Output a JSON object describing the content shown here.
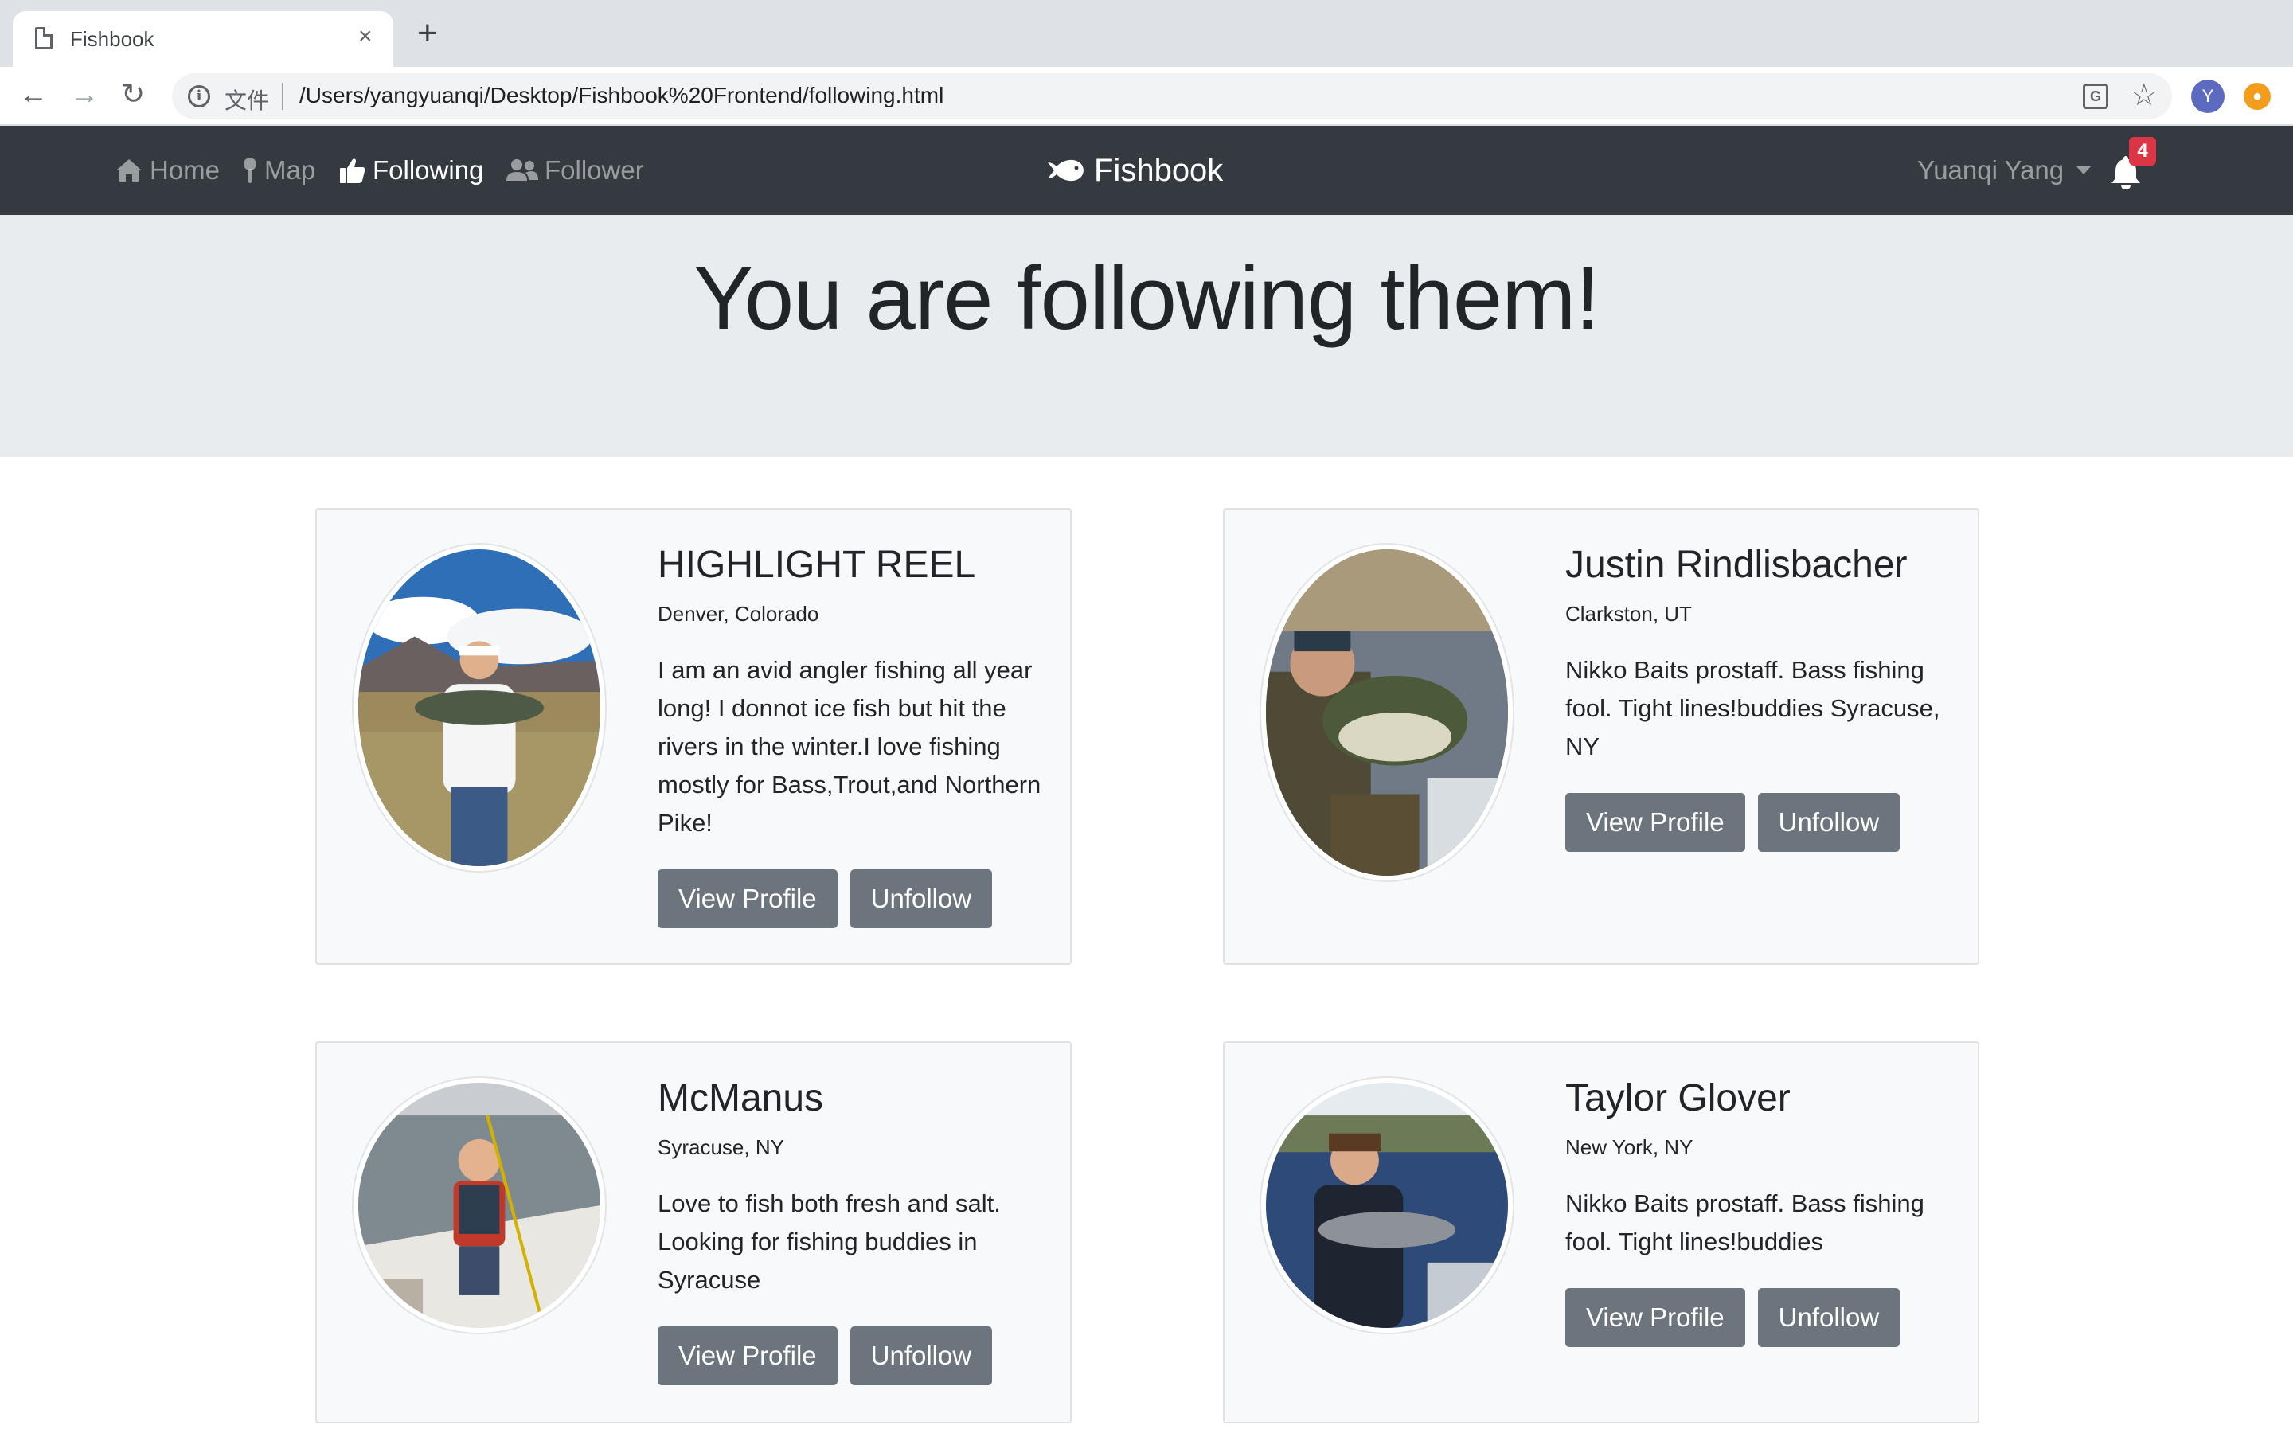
{
  "browser": {
    "tab_title": "Fishbook",
    "tab_close": "×",
    "new_tab": "+",
    "back": "←",
    "forward": "→",
    "reload": "↻",
    "scheme_label": "文件",
    "url": "/Users/yangyuanqi/Desktop/Fishbook%20Frontend/following.html",
    "profile_initial": "Y",
    "bookmark_star": "☆"
  },
  "navbar": {
    "links": [
      {
        "label": "Home",
        "icon": "home-icon",
        "active": false
      },
      {
        "label": "Map",
        "icon": "map-pin-icon",
        "active": false
      },
      {
        "label": "Following",
        "icon": "thumbs-up-icon",
        "active": true
      },
      {
        "label": "Follower",
        "icon": "users-icon",
        "active": false
      }
    ],
    "brand": "Fishbook",
    "user_name": "Yuanqi Yang",
    "notification_count": "4"
  },
  "page": {
    "heading": "You are following them!"
  },
  "cards": [
    {
      "name": "HIGHLIGHT REEL",
      "location": "Denver, Colorado",
      "bio": "I am an avid angler fishing all year long! I donnot ice fish but hit the rivers in the winter.I love fishing mostly for Bass,Trout,and Northern Pike!",
      "view_label": "View Profile",
      "unfollow_label": "Unfollow"
    },
    {
      "name": "Justin Rindlisbacher",
      "location": "Clarkston, UT",
      "bio": "Nikko Baits prostaff. Bass fishing fool. Tight lines!buddies Syracuse, NY",
      "view_label": "View Profile",
      "unfollow_label": "Unfollow"
    },
    {
      "name": "McManus",
      "location": "Syracuse, NY",
      "bio": "Love to fish both fresh and salt. Looking for fishing buddies in Syracuse",
      "view_label": "View Profile",
      "unfollow_label": "Unfollow"
    },
    {
      "name": "Taylor Glover",
      "location": "New York, NY",
      "bio": "Nikko Baits prostaff. Bass fishing fool. Tight lines!buddies",
      "view_label": "View Profile",
      "unfollow_label": "Unfollow"
    }
  ],
  "colors": {
    "navbar_bg": "#343a40",
    "jumbotron_bg": "#e9ecef",
    "button_bg": "#6c757d",
    "badge_bg": "#dc3545"
  }
}
